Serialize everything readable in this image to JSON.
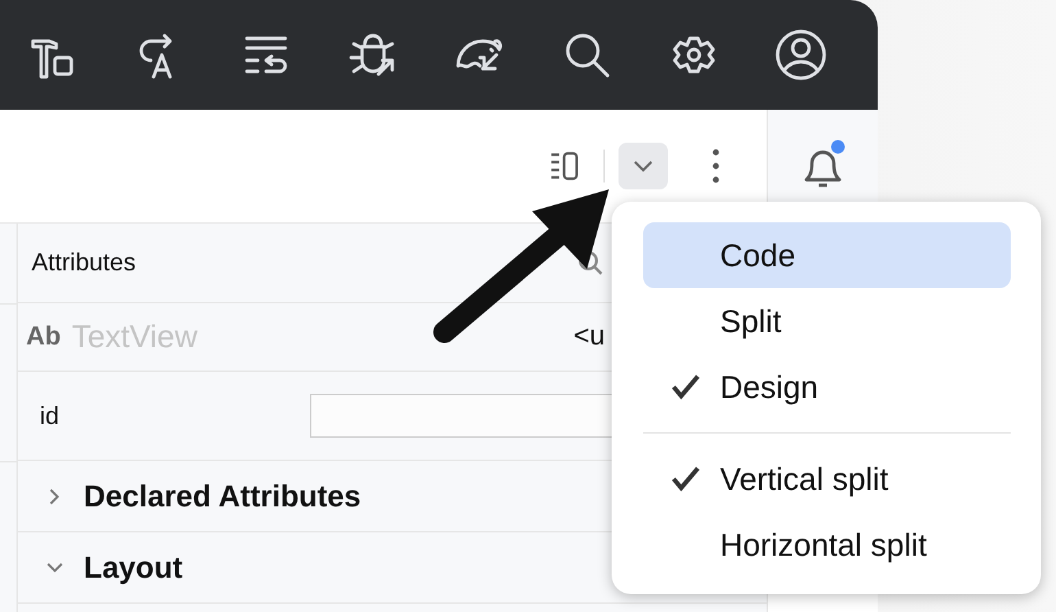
{
  "toolbar": {
    "view_mode_button": {
      "pressed": true
    }
  },
  "notifications": {
    "unread": true
  },
  "attributes_panel": {
    "title": "Attributes",
    "component": {
      "icon_text": "Ab",
      "name": "TextView",
      "value": "<u"
    },
    "id_field": {
      "label": "id"
    },
    "sections": [
      {
        "title": "Declared Attributes",
        "expanded": false
      },
      {
        "title": "Layout",
        "expanded": true
      }
    ]
  },
  "view_menu": {
    "items": [
      {
        "kind": "item",
        "label": "Code",
        "checked": false,
        "selected": true
      },
      {
        "kind": "item",
        "label": "Split",
        "checked": false,
        "selected": false
      },
      {
        "kind": "item",
        "label": "Design",
        "checked": true,
        "selected": false
      },
      {
        "kind": "separator"
      },
      {
        "kind": "item",
        "label": "Vertical split",
        "checked": true,
        "selected": false
      },
      {
        "kind": "item",
        "label": "Horizontal split",
        "checked": false,
        "selected": false
      }
    ]
  }
}
